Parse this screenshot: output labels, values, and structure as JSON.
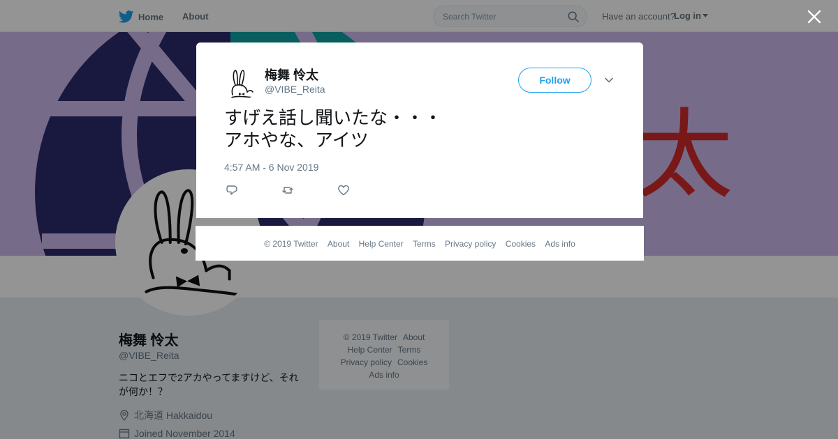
{
  "header": {
    "nav_home": "Home",
    "nav_about": "About",
    "search_placeholder": "Search Twitter",
    "have_account": "Have an account?",
    "login": "Log in"
  },
  "profile": {
    "name": "梅舞 怜太",
    "handle": "@VIBE_Reita",
    "bio": "ニコとエフで2アカやってますけど、それが何か！？",
    "location": "北海道 Hakkaidou",
    "joined": "Joined November 2014",
    "banner_glyph": "太"
  },
  "side_footer": {
    "copyright": "© 2019 Twitter",
    "about": "About",
    "help": "Help Center",
    "terms": "Terms",
    "privacy": "Privacy policy",
    "cookies": "Cookies",
    "ads": "Ads info"
  },
  "tweet": {
    "name": "梅舞 怜太",
    "handle": "@VIBE_Reita",
    "follow_label": "Follow",
    "text_line1": "すげえ話し聞いたな・・・",
    "text_line2": "アホやな、アイツ",
    "timestamp": "4:57 AM - 6 Nov 2019"
  },
  "modal_footer": {
    "copyright": "© 2019 Twitter",
    "about": "About",
    "help": "Help Center",
    "terms": "Terms",
    "privacy": "Privacy policy",
    "cookies": "Cookies",
    "ads": "Ads info"
  },
  "colors": {
    "brand_blue": "#1da1f2",
    "follow_text": "#1da1f2",
    "banner_purple": "#cbb8ea",
    "banner_glyph_red": "#d12a2a"
  },
  "icons": [
    "twitter-bird-icon",
    "search-icon",
    "caret-down-icon",
    "close-icon",
    "chevron-down-icon",
    "reply-icon",
    "retweet-icon",
    "like-icon",
    "location-icon",
    "calendar-icon"
  ]
}
